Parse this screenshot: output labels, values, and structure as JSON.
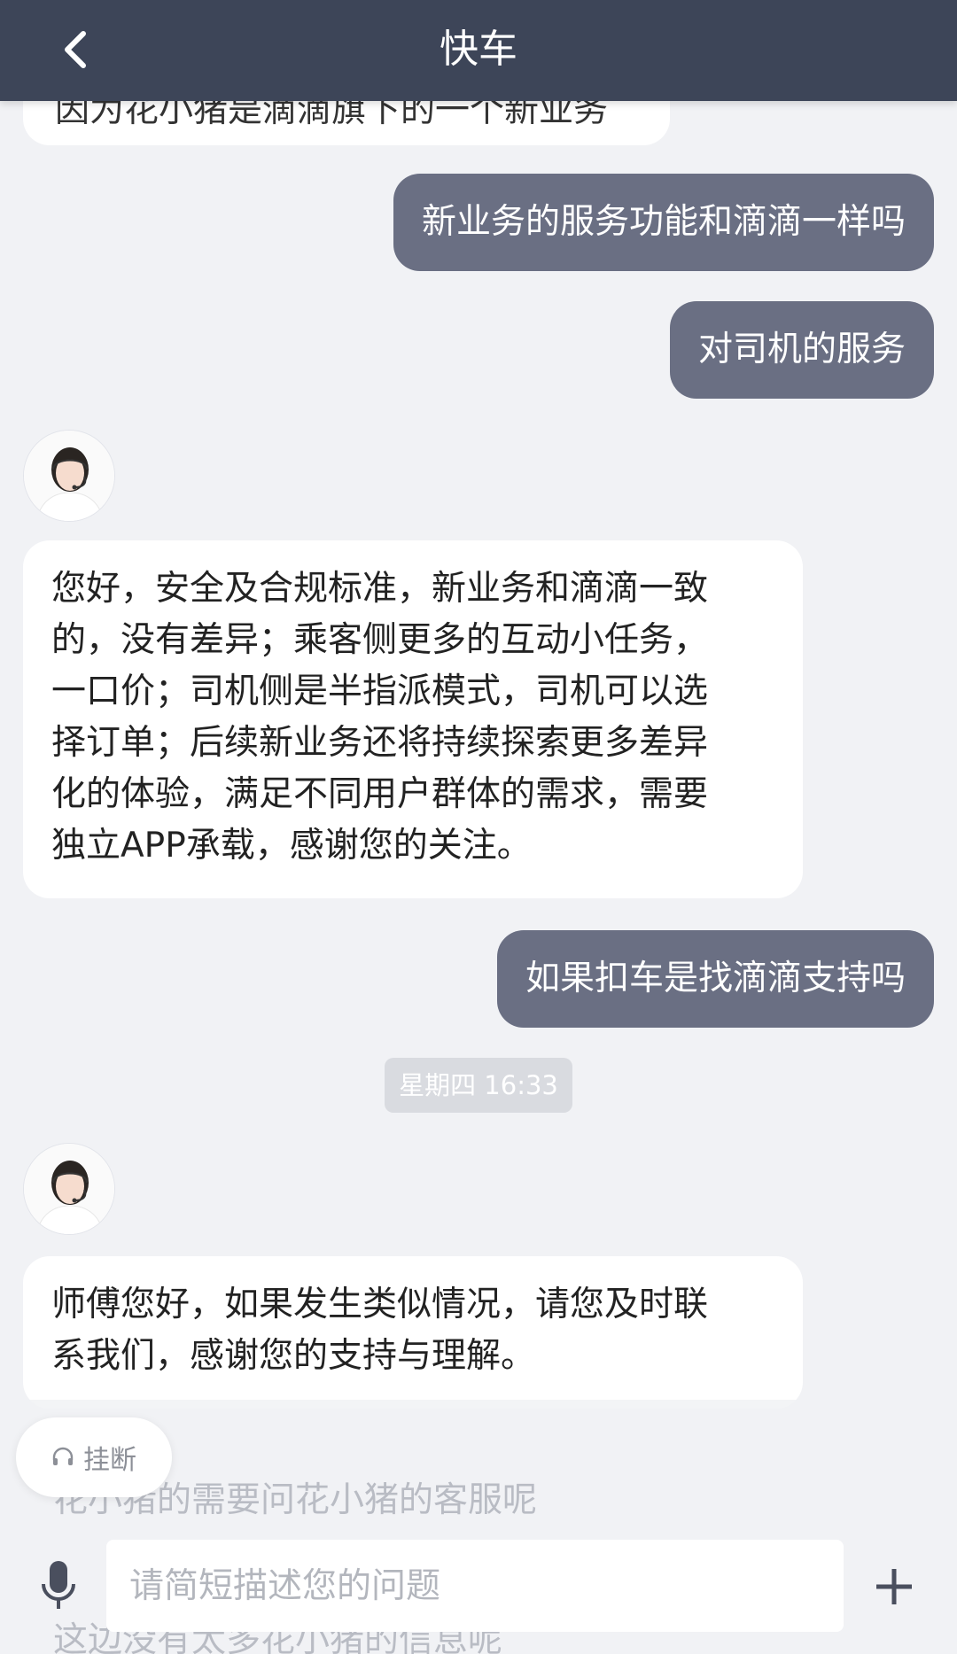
{
  "header": {
    "title": "快车",
    "back_icon": "chevron-left-icon"
  },
  "messages": {
    "partial_top": "因为花小猪是滴滴旗下的一个新业务",
    "user_1": "新业务的服务功能和滴滴一样吗",
    "user_2": "对司机的服务",
    "bot_1_lines": [
      "您好，安全及合规标准，新业务和滴滴一致",
      "的，没有差异；乘客侧更多的互动小任务，",
      "一口价；司机侧是半指派模式，司机可以选",
      "择订单；后续新业务还将持续探索更多差异",
      "化的体验，满足不同用户群体的需求，需要",
      "独立APP承载，感谢您的关注。"
    ],
    "user_3": "如果扣车是找滴滴支持吗",
    "timestamp": "星期四 16:33",
    "bot_2_lines": [
      "师傅您好，如果发生类似情况，请您及时联",
      "系我们，感谢您的支持与理解。"
    ],
    "ghost_1": "花小猪的需要问花小猪的客服呢",
    "ghost_2": "这边没有太多花小猪的信息呢"
  },
  "composer": {
    "hangup_label": "挂断",
    "hangup_icon": "headset-icon",
    "mic_icon": "microphone-icon",
    "placeholder": "请简短描述您的问题",
    "plus_icon": "plus-icon"
  },
  "colors": {
    "header_bg": "#3d4558",
    "user_bubble": "#6a6f83",
    "bot_bubble": "#ffffff",
    "page_bg": "#f1f2f5"
  }
}
